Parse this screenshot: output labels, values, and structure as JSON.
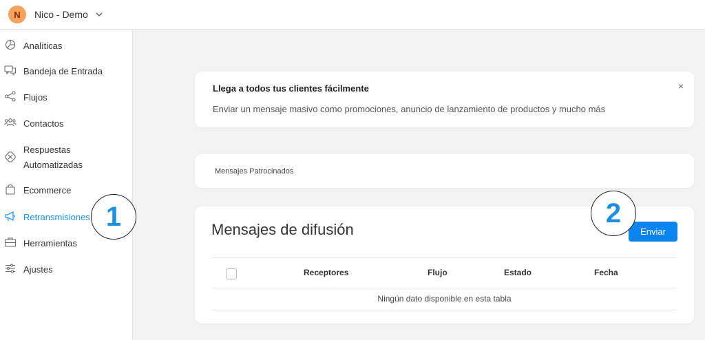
{
  "account": {
    "initial": "N",
    "name": "Nico - Demo"
  },
  "sidebar": {
    "items": [
      {
        "label": "Analíticas",
        "icon": "pie-chart-icon"
      },
      {
        "label": "Bandeja de Entrada",
        "icon": "chat-bubbles-icon"
      },
      {
        "label": "Flujos",
        "icon": "flow-nodes-icon"
      },
      {
        "label": "Contactos",
        "icon": "contacts-icon"
      },
      {
        "label": "Respuestas Automatizadas",
        "icon": "automation-icon"
      },
      {
        "label": "Ecommerce",
        "icon": "shopping-bag-icon"
      },
      {
        "label": "Retransmisiones",
        "icon": "megaphone-icon",
        "active": true
      },
      {
        "label": "Herramientas",
        "icon": "toolbox-icon"
      },
      {
        "label": "Ajustes",
        "icon": "sliders-icon"
      }
    ]
  },
  "callouts": {
    "one": "1",
    "two": "2"
  },
  "banner": {
    "title": "Llega a todos tus clientes fácilmente",
    "text": "Enviar un mensaje masivo como promociones, anuncio de lanzamiento de productos y mucho más",
    "close_symbol": "×"
  },
  "sponsored": {
    "label": "Mensajes Patrocinados"
  },
  "broadcast": {
    "title": "Mensajes de difusión",
    "send_label": "Enviar",
    "columns": [
      "Receptores",
      "Flujo",
      "Estado",
      "Fecha"
    ],
    "empty_message": "Ningún dato disponible en esta tabla"
  },
  "colors": {
    "accent": "#0a84f0",
    "active_nav": "#1a8ff0",
    "avatar_bg": "#f5a25d"
  }
}
